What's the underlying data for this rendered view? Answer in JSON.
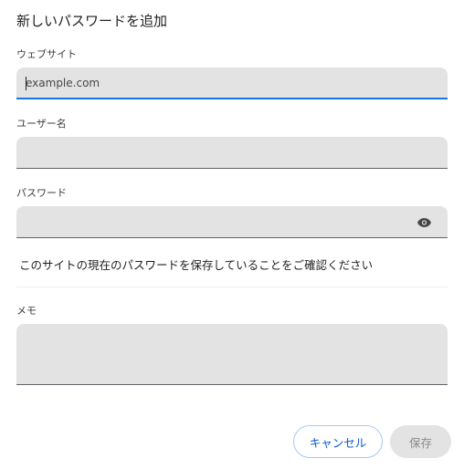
{
  "dialog": {
    "title": "新しいパスワードを追加"
  },
  "website": {
    "label": "ウェブサイト",
    "placeholder": "example.com",
    "value": ""
  },
  "username": {
    "label": "ユーザー名",
    "value": ""
  },
  "password": {
    "label": "パスワード",
    "value": "",
    "toggle_icon": "eye-icon"
  },
  "notice": {
    "text": "このサイトの現在のパスワードを保存していることをご確認ください"
  },
  "memo": {
    "label": "メモ",
    "value": ""
  },
  "buttons": {
    "cancel_label": "キャンセル",
    "save_label": "保存"
  },
  "colors": {
    "accent": "#1a73e8",
    "field_bg": "#e3e3e3",
    "cancel_border": "#a8c7fa",
    "cancel_text": "#0b57d0",
    "disabled_bg": "#e3e3e3",
    "disabled_text": "#8a8a8a"
  }
}
